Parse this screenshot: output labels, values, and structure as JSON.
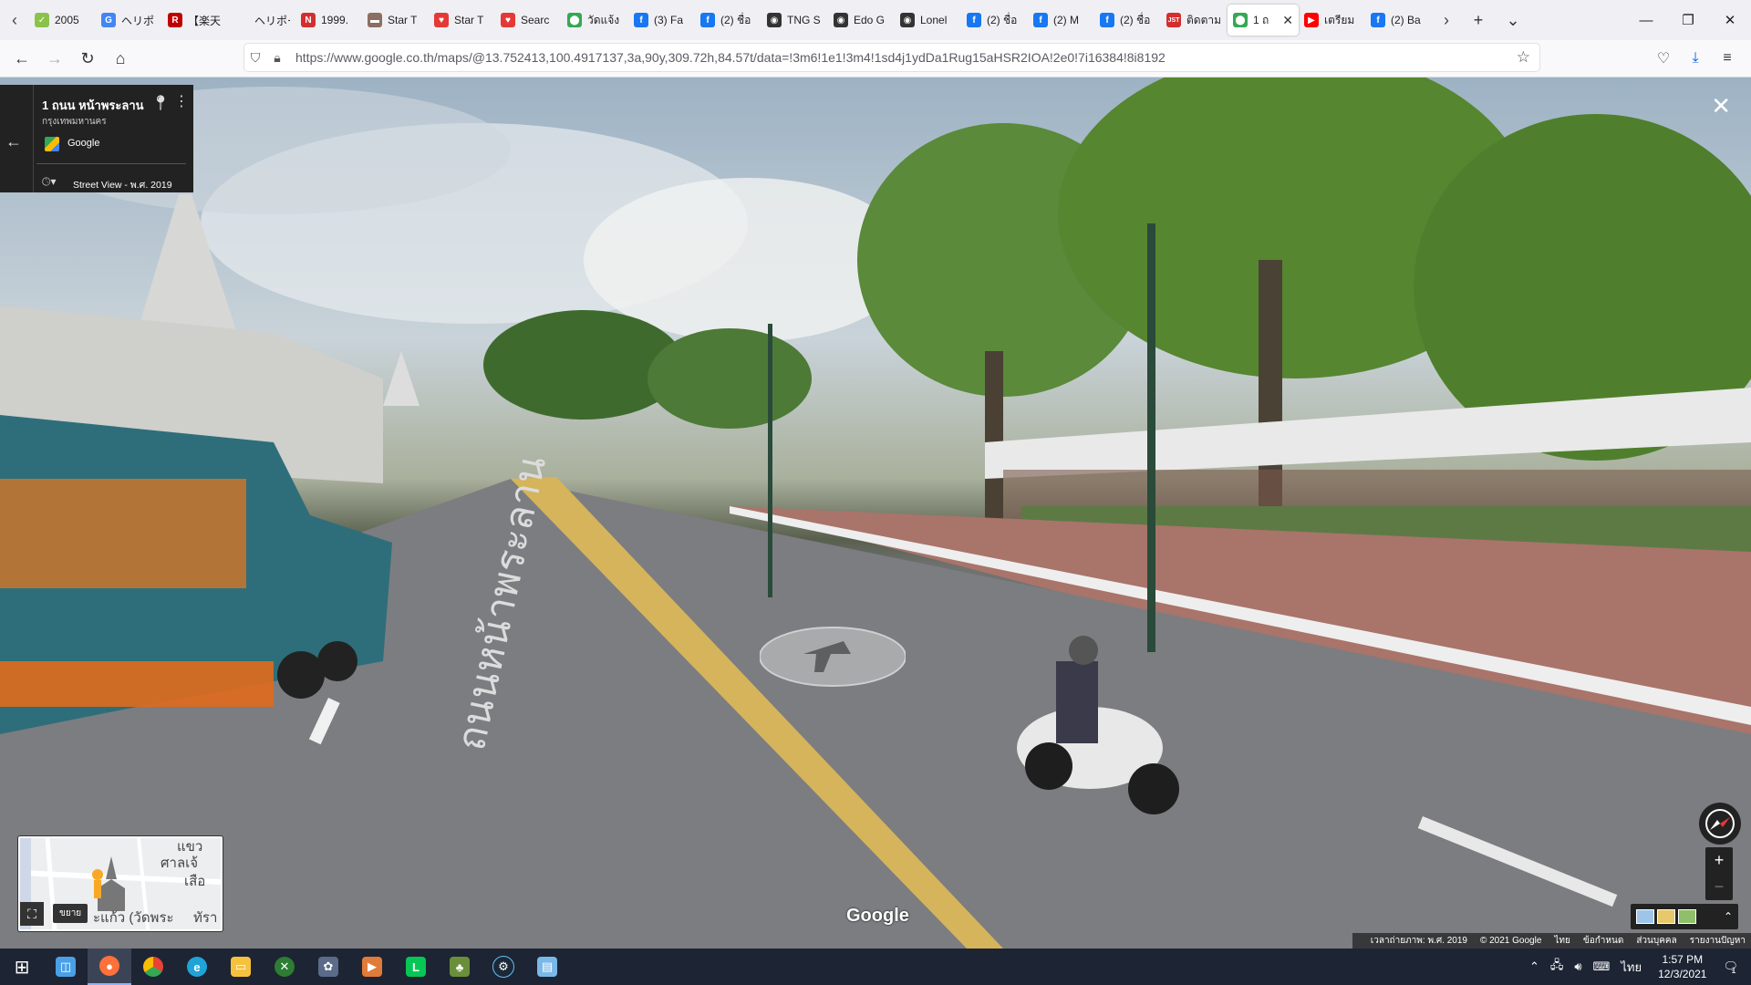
{
  "browser": {
    "tabs": [
      {
        "title": "2005",
        "favicon": "✓",
        "color": "#8bc34a"
      },
      {
        "title": "ヘリポ",
        "favicon": "G",
        "color": "#4285f4"
      },
      {
        "title": "【楽天",
        "favicon": "R",
        "color": "#bf0000"
      },
      {
        "title": "ヘリポー",
        "favicon": "",
        "color": "#f0f0f4"
      },
      {
        "title": "1999.",
        "favicon": "N",
        "color": "#d32f2f"
      },
      {
        "title": "Star T",
        "favicon": "▬",
        "color": "#8d6e63"
      },
      {
        "title": "Star T",
        "favicon": "♥",
        "color": "#e53935"
      },
      {
        "title": "Searc",
        "favicon": "♥",
        "color": "#e53935"
      },
      {
        "title": "วัดแจ้ง",
        "favicon": "⬤",
        "color": "#34a853"
      },
      {
        "title": "(3) Fa",
        "favicon": "f",
        "color": "#1877f2"
      },
      {
        "title": "(2) ชื่อ",
        "favicon": "f",
        "color": "#1877f2"
      },
      {
        "title": "TNG S",
        "favicon": "◉",
        "color": "#333333"
      },
      {
        "title": "Edo G",
        "favicon": "◉",
        "color": "#333333"
      },
      {
        "title": "Lonel",
        "favicon": "◉",
        "color": "#333333"
      },
      {
        "title": "(2) ชื่อ",
        "favicon": "f",
        "color": "#1877f2"
      },
      {
        "title": "(2) M",
        "favicon": "f",
        "color": "#1877f2"
      },
      {
        "title": "(2) ชื่อ",
        "favicon": "f",
        "color": "#1877f2"
      },
      {
        "title": "ติดตาม",
        "favicon": "JST",
        "color": "#d32f2f"
      },
      {
        "title": "1 ถ",
        "favicon": "⬤",
        "color": "#34a853",
        "active": true
      },
      {
        "title": "เตรียม",
        "favicon": "▶",
        "color": "#ff0000"
      },
      {
        "title": "(2) Ba",
        "favicon": "f",
        "color": "#1877f2"
      }
    ],
    "url": "https://www.google.co.th/maps/@13.752413,100.4917137,3a,90y,309.72h,84.57t/data=!3m6!1e1!3m4!1sd4j1ydDa1Rug15aHSR2IOA!2e0!7i16384!8i8192"
  },
  "streetview": {
    "place_title": "1 ถนน หน้าพระลาน",
    "place_subtitle": "กรุงเทพมหานคร",
    "provider": "Google",
    "date_label": "Street View - พ.ศ. 2019",
    "watermark": "Google",
    "minimap": {
      "labels": [
        "แขว",
        "ศาลเจ้",
        "เสือ",
        "ะแก้ว (วัดพระ",
        "ทัรา"
      ],
      "expand_tooltip": "ขยาย"
    },
    "attribution": [
      "เวลาถ่ายภาพ: พ.ศ. 2019",
      "© 2021 Google",
      "ไทย",
      "ข้อกำหนด",
      "ส่วนบุคคล",
      "รายงานปัญหา"
    ],
    "road_text": "ถนนหน้าพระลาน"
  },
  "taskbar": {
    "apps": [
      "start",
      "cortana",
      "firefox",
      "chrome",
      "edge",
      "explorer",
      "xbox",
      "mahjong",
      "media",
      "line",
      "game",
      "steam",
      "notes"
    ],
    "lang": "ไทย",
    "time": "1:57 PM",
    "date": "12/3/2021",
    "notification_count": "1"
  }
}
